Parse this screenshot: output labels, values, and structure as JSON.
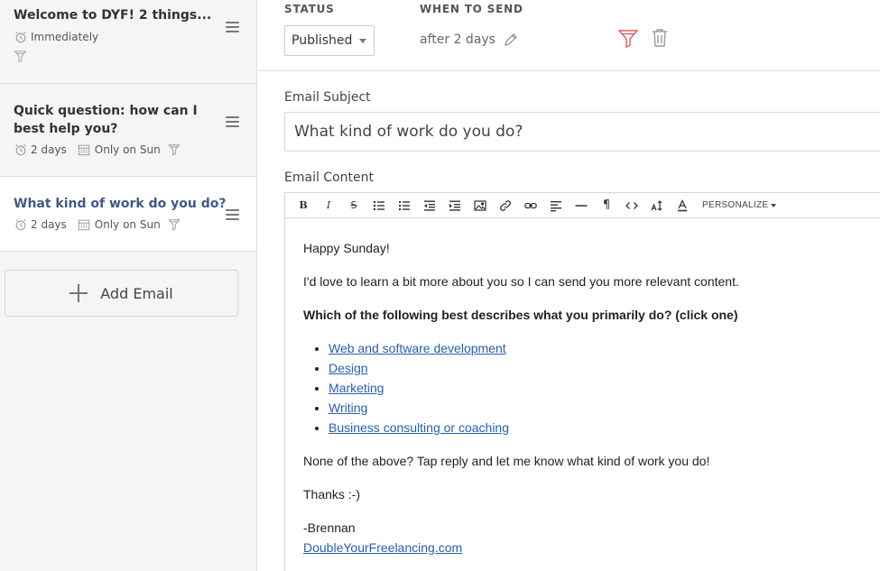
{
  "sidebar": {
    "emails": [
      {
        "title": "Welcome to DYF! 2 things...",
        "delay": "Immediately",
        "days_filter": ""
      },
      {
        "title": "Quick question: how can I best help you?",
        "delay": "2 days",
        "days_filter": "Only on Sun"
      },
      {
        "title": "What kind of work do you do?",
        "delay": "2 days",
        "days_filter": "Only on Sun"
      }
    ],
    "add_email_label": "Add Email"
  },
  "topbar": {
    "status_label": "STATUS",
    "status_value": "Published",
    "when_label": "WHEN TO SEND",
    "when_value": "after 2 days"
  },
  "subject": {
    "label": "Email Subject",
    "value": "What kind of work do you do?"
  },
  "editor": {
    "label": "Email Content",
    "personalize_label": "PERSONALIZE",
    "body": {
      "greeting": "Happy Sunday!",
      "intro": "I'd love to learn a bit more about you so I can send you more relevant content.",
      "question": "Which of the following best describes what you primarily do? (click one)",
      "options": [
        "Web and software development",
        "Design",
        "Marketing",
        "Writing",
        "Business consulting or coaching"
      ],
      "followup": "None of the above? Tap reply and let me know what kind of work you do!",
      "thanks": "Thanks :-)",
      "signature_name": "-Brennan",
      "signature_link": "DoubleYourFreelancing.com"
    }
  },
  "colors": {
    "active_title": "#3e5a86",
    "link": "#2a5db0",
    "filter_active": "#e05a5a"
  }
}
